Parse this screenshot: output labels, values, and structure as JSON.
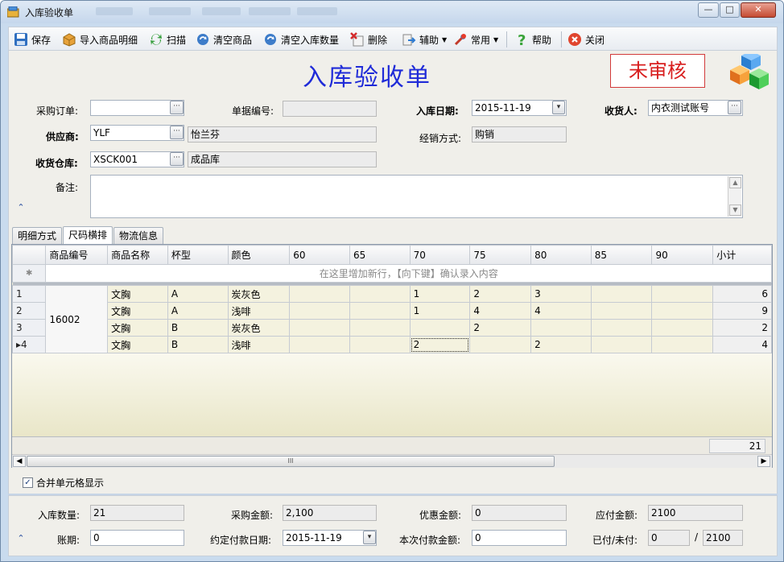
{
  "window": {
    "title": "入库验收单",
    "min_label": "—",
    "max_label": "□",
    "close_label": "✕"
  },
  "toolbar": {
    "save": "保存",
    "import": "导入商品明细",
    "scan": "扫描",
    "clear_goods": "清空商品",
    "clear_qty": "清空入库数量",
    "delete": "删除",
    "assist": "辅助",
    "common": "常用",
    "help": "帮助",
    "close": "关闭"
  },
  "header": {
    "doc_title": "入库验收单",
    "status": "未审核"
  },
  "form": {
    "po_label": "采购订单:",
    "po_value": "",
    "doc_no_label": "单据编号:",
    "doc_no_value": "",
    "in_date_label": "入库日期:",
    "in_date_value": "2015-11-19",
    "receiver_label": "收货人:",
    "receiver_value": "内衣测试账号",
    "supplier_label": "供应商:",
    "supplier_code": "YLF",
    "supplier_name": "怡兰芬",
    "sales_mode_label": "经销方式:",
    "sales_mode_value": "购销",
    "warehouse_label": "收货仓库:",
    "warehouse_code": "XSCK001",
    "warehouse_name": "成品库",
    "remark_label": "备注:",
    "remark_value": ""
  },
  "tabs": [
    "明细方式",
    "尺码横排",
    "物流信息"
  ],
  "grid": {
    "columns": [
      "商品编号",
      "商品名称",
      "杯型",
      "颜色",
      "60",
      "65",
      "70",
      "75",
      "80",
      "85",
      "90",
      "小计"
    ],
    "new_row_hint": "在这里增加新行，【向下键】确认录入内容",
    "new_row_marker": "✱",
    "product_code": "16002",
    "rows": [
      {
        "idx": "1",
        "name": "文胸",
        "cup": "A",
        "color": "炭灰色",
        "s60": "",
        "s65": "",
        "s70": "1",
        "s75": "2",
        "s80": "3",
        "s85": "",
        "s90": "",
        "subtotal": "6"
      },
      {
        "idx": "2",
        "name": "文胸",
        "cup": "A",
        "color": "浅啡",
        "s60": "",
        "s65": "",
        "s70": "1",
        "s75": "4",
        "s80": "4",
        "s85": "",
        "s90": "",
        "subtotal": "9"
      },
      {
        "idx": "3",
        "name": "文胸",
        "cup": "B",
        "color": "炭灰色",
        "s60": "",
        "s65": "",
        "s70": "",
        "s75": "2",
        "s80": "",
        "s85": "",
        "s90": "",
        "subtotal": "2"
      },
      {
        "idx": "▸4",
        "name": "文胸",
        "cup": "B",
        "color": "浅啡",
        "s60": "",
        "s65": "",
        "s70": "2",
        "s75": "",
        "s80": "2",
        "s85": "",
        "s90": "",
        "subtotal": "4"
      }
    ],
    "total": "21",
    "scroll_thumb_label": "III"
  },
  "merge_cells_label": "合并单元格显示",
  "bottom": {
    "in_qty_label": "入库数量:",
    "in_qty_value": "21",
    "purchase_amt_label": "采购金额:",
    "purchase_amt_value": "2,100",
    "discount_label": "优惠金额:",
    "discount_value": "0",
    "payable_label": "应付金额:",
    "payable_value": "2100",
    "term_label": "账期:",
    "term_value": "0",
    "due_date_label": "约定付款日期:",
    "due_date_value": "2015-11-19",
    "pay_now_label": "本次付款金额:",
    "pay_now_value": "0",
    "paid_label": "已付/未付:",
    "paid_value": "0",
    "slash": "/",
    "unpaid_value": "2100"
  },
  "colors": {
    "title_blue": "#1f2bd8",
    "status_red": "#d81e1e",
    "window_frame": "#c9dbee"
  }
}
